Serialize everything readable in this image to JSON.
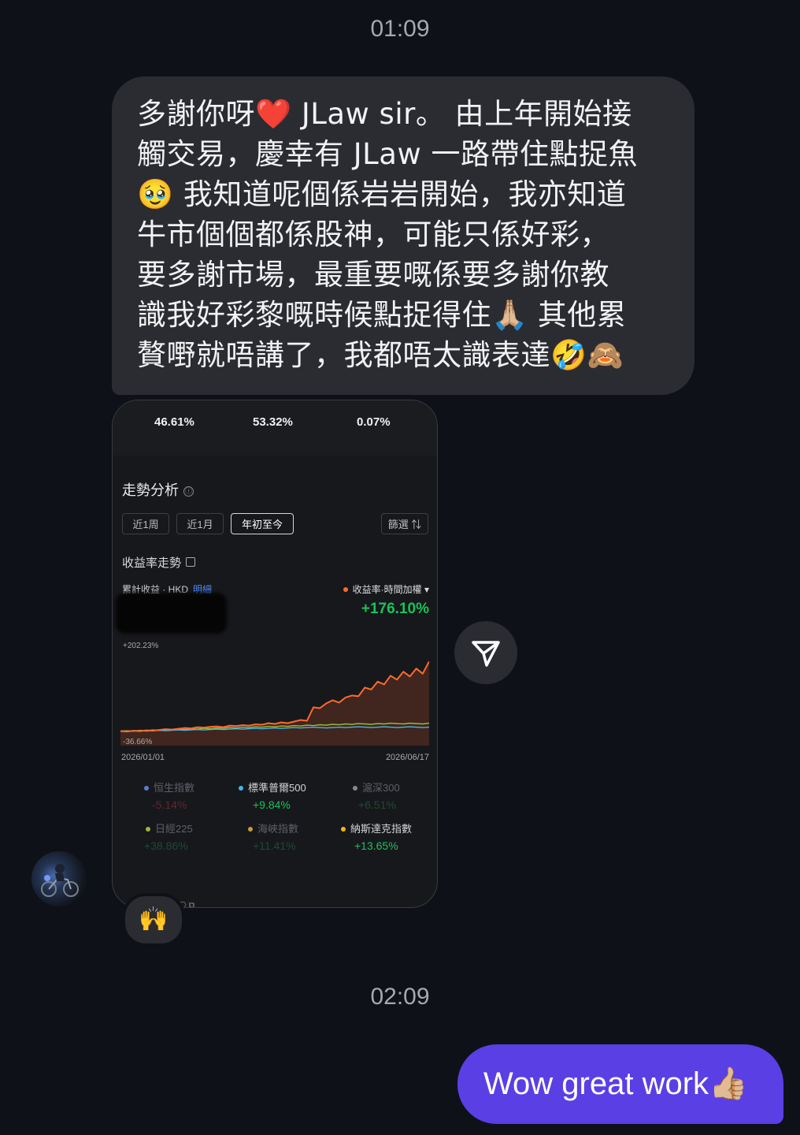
{
  "timestamps": {
    "first": "01:09",
    "second": "02:09"
  },
  "incoming_message": {
    "lines": [
      "多謝你呀❤️ JLaw sir。 由上年開始接",
      "觸交易，慶幸有 JLaw 一路帶住點捉魚",
      "🥹 我知道呢個係岩岩開始，我亦知道",
      "牛市個個都係股神，可能只係好彩，",
      "要多謝市場，最重要嘅係要多謝你教",
      "識我好彩黎嘅時候點捉得住🙏🏼 其他累",
      "贅嘢就唔講了，我都唔太識表達🤣🙈"
    ],
    "reaction": "🙌"
  },
  "screenshot": {
    "top_percentages": [
      "46.61%",
      "53.32%",
      "0.07%"
    ],
    "section_title": "走勢分析",
    "info_icon": "ⓘ",
    "period_pills": [
      {
        "label": "近1周",
        "active": false
      },
      {
        "label": "近1月",
        "active": false
      },
      {
        "label": "年初至今",
        "active": true
      }
    ],
    "filter_label": "篩選 ⇅",
    "returns_title": "收益率走勢",
    "cumulative_label": "累計收益 · HKD",
    "detail_link": "明細",
    "series_selector": "收益率·時間加權 ▾",
    "total_return": "+176.10%",
    "colors": {
      "accent_orange": "#ff6a2c",
      "positive_green": "#19c25a",
      "link_blue": "#4a8cff",
      "outgoing_bubble": "#5a3fe5"
    },
    "benchmarks": [
      {
        "name": "恒生指數",
        "value": "-5.14%",
        "dot": "#5b7bd6",
        "highlighted": false
      },
      {
        "name": "標準普爾500",
        "value": "+9.84%",
        "dot": "#3fb8f0",
        "highlighted": true
      },
      {
        "name": "滬深300",
        "value": "+6.51%",
        "dot": "#888888",
        "highlighted": false
      },
      {
        "name": "日經225",
        "value": "+38.86%",
        "dot": "#9ab83a",
        "highlighted": false
      },
      {
        "name": "海峽指數",
        "value": "+11.41%",
        "dot": "#c89a3a",
        "highlighted": false
      },
      {
        "name": "納斯達克指數",
        "value": "+13.65%",
        "dot": "#f5b800",
        "highlighted": true
      }
    ],
    "chart_data": {
      "type": "line",
      "x_range": [
        "2026/01/01",
        "2026/06/17"
      ],
      "y_axis_labels": {
        "max": "+202.23%",
        "min": "-36.66%"
      },
      "ylim": [
        -36.66,
        202.23
      ],
      "series": [
        {
          "color": "#ff6a2c",
          "values": [
            0,
            -1,
            1,
            0,
            2,
            1,
            3,
            5,
            4,
            6,
            8,
            7,
            10,
            9,
            11,
            12,
            10,
            14,
            13,
            15,
            14,
            17,
            16,
            20,
            18,
            22,
            20,
            24,
            28,
            26,
            60,
            58,
            70,
            78,
            72,
            85,
            90,
            88,
            110,
            105,
            125,
            118,
            140,
            130,
            150,
            138,
            158,
            145,
            176
          ]
        },
        {
          "color": "#3fb8f0",
          "values": [
            0,
            0,
            1,
            1,
            0,
            1,
            2,
            1,
            2,
            3,
            2,
            3,
            4,
            3,
            4,
            5,
            4,
            5,
            6,
            5,
            6,
            7,
            6,
            7,
            8,
            7,
            8,
            9,
            8,
            9,
            10,
            9,
            8,
            9,
            10,
            9,
            10,
            11,
            10,
            9,
            10,
            11,
            10,
            9,
            10,
            11,
            10,
            9,
            10
          ]
        },
        {
          "color": "#9ab83a",
          "values": [
            0,
            1,
            0,
            2,
            1,
            3,
            2,
            4,
            3,
            5,
            4,
            6,
            5,
            7,
            6,
            8,
            7,
            9,
            8,
            10,
            9,
            11,
            10,
            12,
            11,
            13,
            12,
            14,
            13,
            15,
            14,
            16,
            15,
            17,
            16,
            18,
            17,
            19,
            18,
            17,
            19,
            18,
            20,
            19,
            18,
            20,
            19,
            18,
            20
          ]
        }
      ]
    }
  },
  "outgoing_message": {
    "text": "Wow great work👍🏼"
  }
}
